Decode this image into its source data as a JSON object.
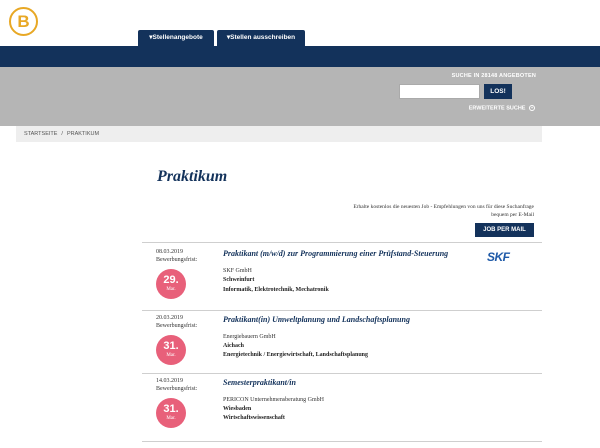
{
  "logo": {
    "letter": "B"
  },
  "nav": {
    "tab1_label": "▾Stellenangebote",
    "tab2_label": "▾Stellen ausschreiben"
  },
  "search": {
    "label": "SUCHE IN 28148 ANGEBOTEN",
    "input_value": "",
    "button_label": "LOS!",
    "advanced_label": "ERWEITERTE SUCHE"
  },
  "breadcrumb": {
    "home": "STARTSEITE",
    "separator": "/",
    "current": "PRAKTIKUM"
  },
  "page": {
    "title": "Praktikum",
    "alert_text": "Erhalte kostenlos die neuesten Job - Empfehlungen von uns für diese Suchanfrage bequem per E-Mail",
    "alert_button": "JOB PER MAIL"
  },
  "jobs": [
    {
      "date": "08.03.2019",
      "deadline_label": "Bewerbungsfrist:",
      "deadline_day": "29.",
      "deadline_month": "Mar.",
      "title": "Praktikant (m/w/d) zur Programmierung einer Prüfstand-Steuerung",
      "company": "SKF GmbH",
      "location": "Schweinfurt",
      "field": "Informatik, Elektrotechnik, Mechatronik",
      "logo_text": "SKF"
    },
    {
      "date": "20.03.2019",
      "deadline_label": "Bewerbungsfrist:",
      "deadline_day": "31.",
      "deadline_month": "Mar.",
      "title": "Praktikant(in) Umweltplanung und Landschaftsplanung",
      "company": "Energiebauern GmbH",
      "location": "Aichach",
      "field": "Energietechnik / Energiewirtschaft, Landschaftsplanung"
    },
    {
      "date": "14.03.2019",
      "deadline_label": "Bewerbungsfrist:",
      "deadline_day": "31.",
      "deadline_month": "Mar.",
      "title": "Semesterpraktikant/in",
      "company": "PERICON Unternehmensberatung GmbH",
      "location": "Wiesbaden",
      "field": "Wirtschaftswissenschaft"
    }
  ],
  "colors": {
    "navy": "#13325b",
    "accent_gold": "#e8a825",
    "badge_pink": "#e8607a",
    "search_band_gray": "#b5b5b5"
  },
  "icons": {
    "advanced_search": "plus-circle-icon"
  }
}
